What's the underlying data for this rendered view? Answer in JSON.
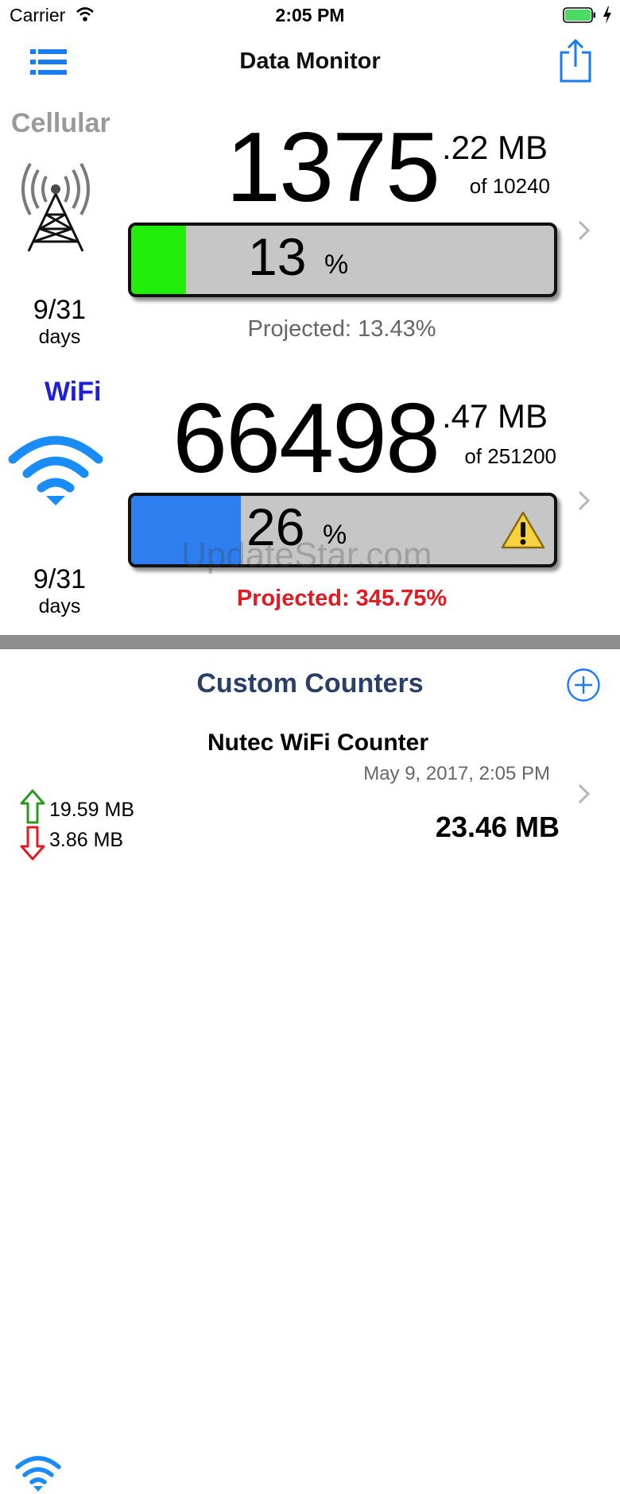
{
  "status_bar": {
    "carrier": "Carrier",
    "time": "2:05 PM"
  },
  "nav": {
    "title": "Data Monitor"
  },
  "cellular": {
    "label": "Cellular",
    "used_whole": "1375",
    "used_decimal": ".22 MB",
    "of_total": "of 10240",
    "percent": "13",
    "percent_sign": "%",
    "fill_fraction": 0.13,
    "projected": "Projected: 13.43%",
    "days": "9/31",
    "days_unit": "days"
  },
  "wifi": {
    "label": "WiFi",
    "used_whole": "66498",
    "used_decimal": ".47 MB",
    "of_total": "of 251200",
    "percent": "26",
    "percent_sign": "%",
    "fill_fraction": 0.26,
    "projected": "Projected: 345.75%",
    "days": "9/31",
    "days_unit": "days"
  },
  "watermark": "UpdateStar.com",
  "custom_counters": {
    "title": "Custom Counters",
    "items": [
      {
        "name": "Nutec WiFi Counter",
        "date": "May 9, 2017, 2:05 PM",
        "upload": "19.59 MB",
        "download": "3.86 MB",
        "total": "23.46 MB"
      }
    ]
  },
  "colors": {
    "accent": "#1a7cf2",
    "cellular_fill": "#22ee0c",
    "wifi_fill": "#2f7ef0",
    "warning_text": "#e01b24",
    "counters_title": "#2a3e6a",
    "upload_arrow": "#2a9a1f",
    "download_arrow": "#e01b24"
  },
  "icons": {
    "menu": "list-menu-icon",
    "share": "share-icon",
    "cell_tower": "cell-tower-icon",
    "wifi": "wifi-icon",
    "warning": "warning-icon",
    "add": "plus-circle-icon",
    "chevron": "chevron-right-icon"
  }
}
